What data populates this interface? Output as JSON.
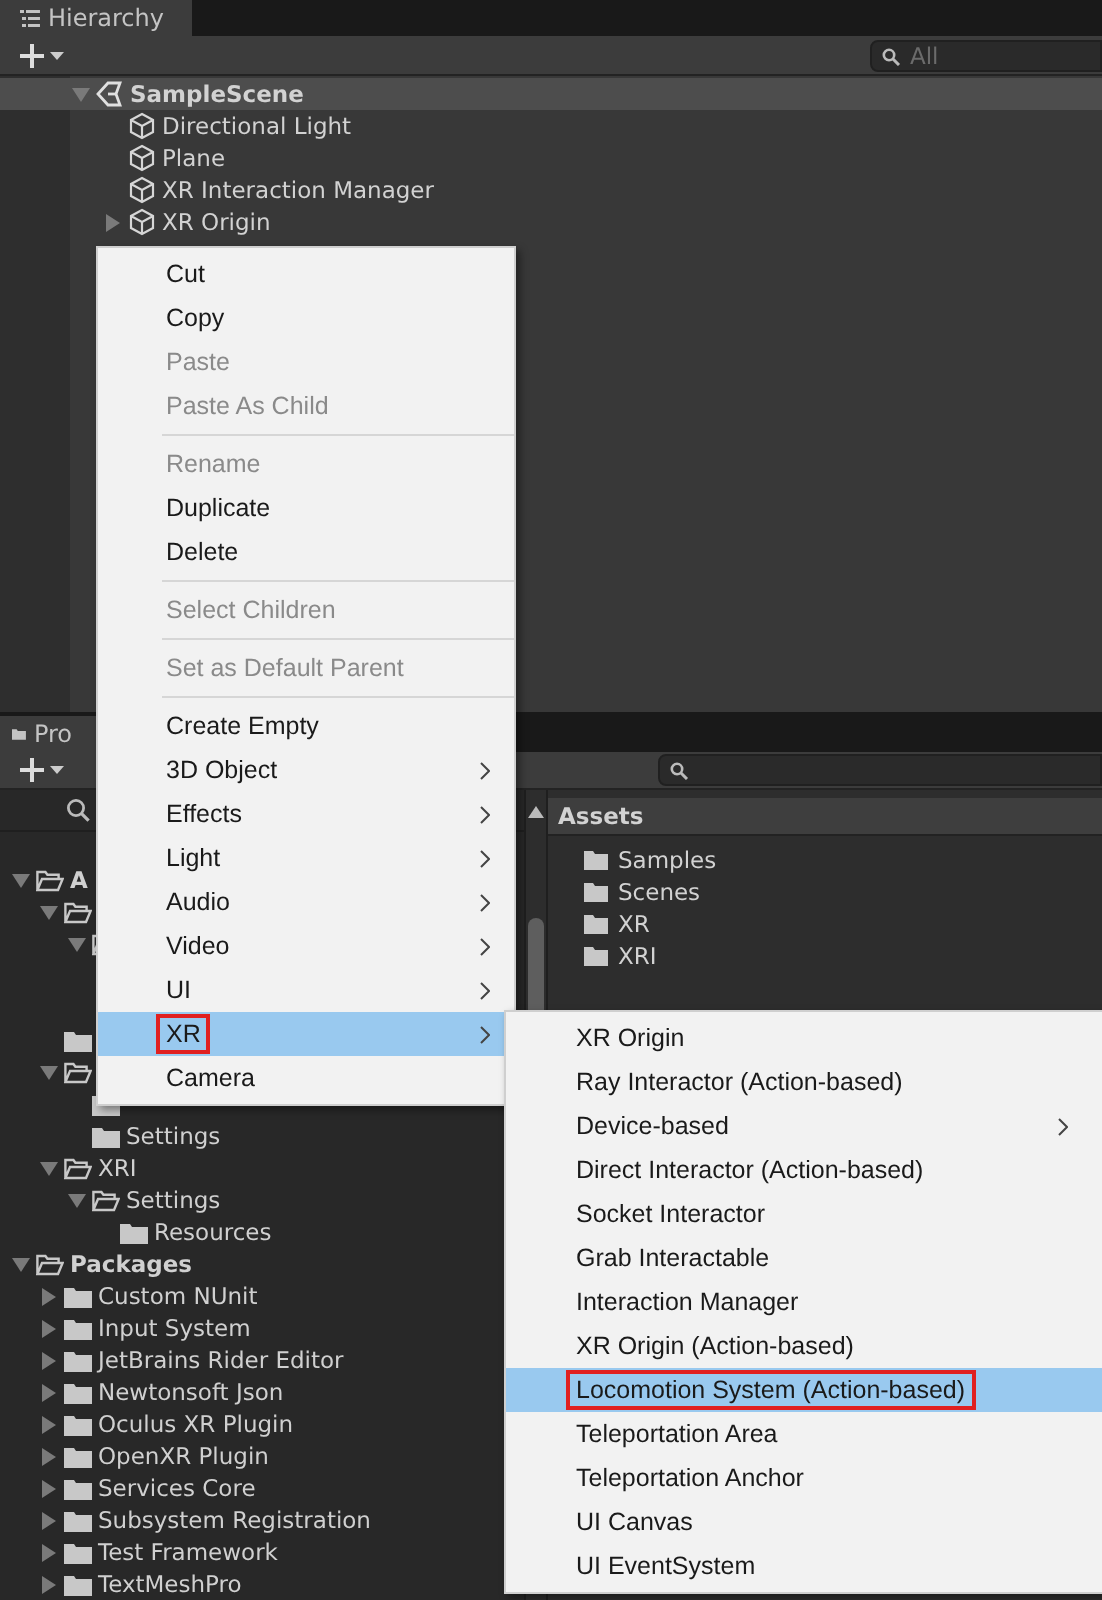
{
  "hierarchy": {
    "title": "Hierarchy",
    "search": {
      "placeholder": "All"
    },
    "tree": [
      {
        "label": "SampleScene",
        "kind": "scene",
        "selected": true,
        "expanded": true,
        "children": [
          {
            "label": "Directional Light",
            "kind": "object",
            "selected": false
          },
          {
            "label": "Plane",
            "kind": "object",
            "selected": false
          },
          {
            "label": "XR Interaction Manager",
            "kind": "object",
            "selected": false
          },
          {
            "label": "XR Origin",
            "kind": "object",
            "selected": false,
            "expanded": false
          }
        ]
      }
    ]
  },
  "project": {
    "title": "Pro",
    "tree": [
      {
        "label": "A",
        "bold": true,
        "expanded": true,
        "children": [
          {
            "expanded": true,
            "children": [
              {
                "expanded": true,
                "children": [
                  {
                    "kind": "covered"
                  },
                  {
                    "kind": "covered"
                  }
                ]
              }
            ]
          },
          {
            "kind": "folder"
          },
          {
            "expanded": true,
            "children": [
              {
                "kind": "folder"
              },
              {
                "label": "Settings"
              }
            ]
          },
          {
            "label": "XRI",
            "expanded": true,
            "children": [
              {
                "label": "Settings",
                "expanded": true,
                "children": [
                  {
                    "label": "Resources"
                  }
                ]
              }
            ]
          }
        ]
      },
      {
        "label": "Packages",
        "bold": true,
        "expanded": true,
        "children": [
          {
            "label": "Custom NUnit",
            "expanded": false
          },
          {
            "label": "Input System",
            "expanded": false
          },
          {
            "label": "JetBrains Rider Editor",
            "expanded": false
          },
          {
            "label": "Newtonsoft Json",
            "expanded": false
          },
          {
            "label": "Oculus XR Plugin",
            "expanded": false
          },
          {
            "label": "OpenXR Plugin",
            "expanded": false
          },
          {
            "label": "Services Core",
            "expanded": false
          },
          {
            "label": "Subsystem Registration",
            "expanded": false
          },
          {
            "label": "Test Framework",
            "expanded": false
          },
          {
            "label": "TextMeshPro",
            "expanded": false
          }
        ]
      }
    ],
    "assets": {
      "title": "Assets",
      "items": [
        "Samples",
        "Scenes",
        "XR",
        "XRI"
      ]
    }
  },
  "context_menu": {
    "items": [
      {
        "kind": "item",
        "label": "Cut",
        "disabled": false,
        "submenu": false,
        "selected": false,
        "outlined": false
      },
      {
        "kind": "item",
        "label": "Copy",
        "disabled": false,
        "submenu": false,
        "selected": false,
        "outlined": false
      },
      {
        "kind": "item",
        "label": "Paste",
        "disabled": true,
        "submenu": false,
        "selected": false,
        "outlined": false
      },
      {
        "kind": "item",
        "label": "Paste As Child",
        "disabled": true,
        "submenu": false,
        "selected": false,
        "outlined": false
      },
      {
        "kind": "separator"
      },
      {
        "kind": "item",
        "label": "Rename",
        "disabled": true,
        "submenu": false,
        "selected": false,
        "outlined": false
      },
      {
        "kind": "item",
        "label": "Duplicate",
        "disabled": false,
        "submenu": false,
        "selected": false,
        "outlined": false
      },
      {
        "kind": "item",
        "label": "Delete",
        "disabled": false,
        "submenu": false,
        "selected": false,
        "outlined": false
      },
      {
        "kind": "separator"
      },
      {
        "kind": "item",
        "label": "Select Children",
        "disabled": true,
        "submenu": false,
        "selected": false,
        "outlined": false
      },
      {
        "kind": "separator"
      },
      {
        "kind": "item",
        "label": "Set as Default Parent",
        "disabled": true,
        "submenu": false,
        "selected": false,
        "outlined": false
      },
      {
        "kind": "separator"
      },
      {
        "kind": "item",
        "label": "Create Empty",
        "disabled": false,
        "submenu": false,
        "selected": false,
        "outlined": false
      },
      {
        "kind": "item",
        "label": "3D Object",
        "disabled": false,
        "submenu": true,
        "selected": false,
        "outlined": false
      },
      {
        "kind": "item",
        "label": "Effects",
        "disabled": false,
        "submenu": true,
        "selected": false,
        "outlined": false
      },
      {
        "kind": "item",
        "label": "Light",
        "disabled": false,
        "submenu": true,
        "selected": false,
        "outlined": false
      },
      {
        "kind": "item",
        "label": "Audio",
        "disabled": false,
        "submenu": true,
        "selected": false,
        "outlined": false
      },
      {
        "kind": "item",
        "label": "Video",
        "disabled": false,
        "submenu": true,
        "selected": false,
        "outlined": false
      },
      {
        "kind": "item",
        "label": "UI",
        "disabled": false,
        "submenu": true,
        "selected": false,
        "outlined": false
      },
      {
        "kind": "item",
        "label": "XR",
        "disabled": false,
        "submenu": true,
        "selected": true,
        "outlined": true
      },
      {
        "kind": "item",
        "label": "Camera",
        "disabled": false,
        "submenu": false,
        "selected": false,
        "outlined": false
      }
    ]
  },
  "submenu": {
    "items": [
      {
        "kind": "item",
        "label": "XR Origin",
        "disabled": false,
        "submenu": false,
        "selected": false,
        "outlined": false
      },
      {
        "kind": "item",
        "label": "Ray Interactor (Action-based)",
        "disabled": false,
        "submenu": false,
        "selected": false,
        "outlined": false
      },
      {
        "kind": "item",
        "label": "Device-based",
        "disabled": false,
        "submenu": true,
        "selected": false,
        "outlined": false
      },
      {
        "kind": "item",
        "label": "Direct Interactor (Action-based)",
        "disabled": false,
        "submenu": false,
        "selected": false,
        "outlined": false
      },
      {
        "kind": "item",
        "label": "Socket Interactor",
        "disabled": false,
        "submenu": false,
        "selected": false,
        "outlined": false
      },
      {
        "kind": "item",
        "label": "Grab Interactable",
        "disabled": false,
        "submenu": false,
        "selected": false,
        "outlined": false
      },
      {
        "kind": "item",
        "label": "Interaction Manager",
        "disabled": false,
        "submenu": false,
        "selected": false,
        "outlined": false
      },
      {
        "kind": "item",
        "label": "XR Origin (Action-based)",
        "disabled": false,
        "submenu": false,
        "selected": false,
        "outlined": false
      },
      {
        "kind": "item",
        "label": "Locomotion System (Action-based)",
        "disabled": false,
        "submenu": false,
        "selected": true,
        "outlined": true
      },
      {
        "kind": "item",
        "label": "Teleportation Area",
        "disabled": false,
        "submenu": false,
        "selected": false,
        "outlined": false
      },
      {
        "kind": "item",
        "label": "Teleportation Anchor",
        "disabled": false,
        "submenu": false,
        "selected": false,
        "outlined": false
      },
      {
        "kind": "item",
        "label": "UI Canvas",
        "disabled": false,
        "submenu": false,
        "selected": false,
        "outlined": false
      },
      {
        "kind": "item",
        "label": "UI EventSystem",
        "disabled": false,
        "submenu": false,
        "selected": false,
        "outlined": false
      }
    ]
  }
}
